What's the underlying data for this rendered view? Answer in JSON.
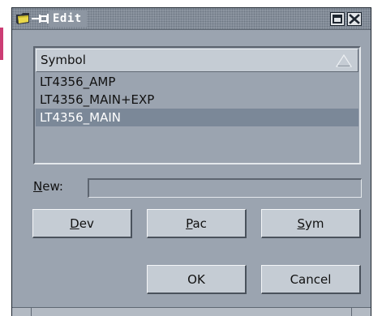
{
  "window": {
    "title": "Edit"
  },
  "list": {
    "header": "Symbol",
    "items": [
      {
        "label": "LT4356_AMP"
      },
      {
        "label": "LT4356_MAIN+EXP"
      },
      {
        "label": "LT4356_MAIN"
      }
    ],
    "selected_index": 2
  },
  "new_field": {
    "label_first": "N",
    "label_rest": "ew:",
    "value": "",
    "placeholder": ""
  },
  "buttons": {
    "dev": {
      "mnemonic": "D",
      "rest": "ev"
    },
    "pac": {
      "mnemonic": "P",
      "rest": "ac"
    },
    "sym": {
      "mnemonic": "S",
      "rest": "ym"
    },
    "ok": {
      "label": "OK"
    },
    "cancel": {
      "label": "Cancel"
    }
  },
  "icons": {
    "app": "folder-icon",
    "pin": "pin-icon",
    "sort": "sort-triangle-icon",
    "maximize": "maximize-icon",
    "close": "close-icon"
  },
  "colors": {
    "window_bg": "#9ba4b0",
    "button_bg": "#c5ccd4",
    "selection_bg": "#7b8898",
    "title_text": "#ffffff"
  }
}
